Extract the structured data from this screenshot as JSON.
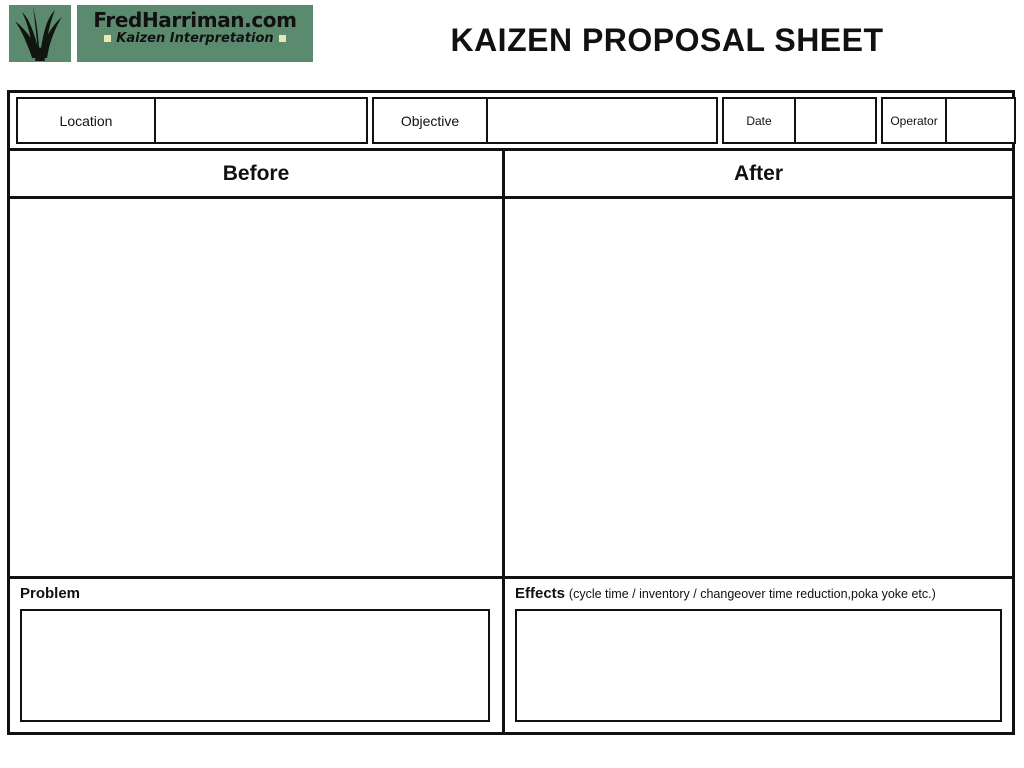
{
  "document": {
    "title": "KAIZEN PROPOSAL SHEET"
  },
  "logo": {
    "mark_icon": "grass-plant-icon",
    "brand": "FredHarriman.com",
    "tagline": "Kaizen Interpretation",
    "background_color": "#5c8a6f",
    "accent_square_color": "#e8e8b4"
  },
  "meta": {
    "location": {
      "label": "Location",
      "value": ""
    },
    "objective": {
      "label": "Objective",
      "value": ""
    },
    "date": {
      "label": "Date",
      "value": ""
    },
    "operator": {
      "label": "Operator",
      "value": ""
    }
  },
  "comparison": {
    "before": {
      "heading": "Before",
      "content": ""
    },
    "after": {
      "heading": "After",
      "content": ""
    }
  },
  "problem": {
    "label": "Problem",
    "hint": "",
    "value": ""
  },
  "effects": {
    "label": "Effects",
    "hint": "(cycle time / inventory / changeover time reduction,poka yoke etc.)",
    "value": ""
  }
}
